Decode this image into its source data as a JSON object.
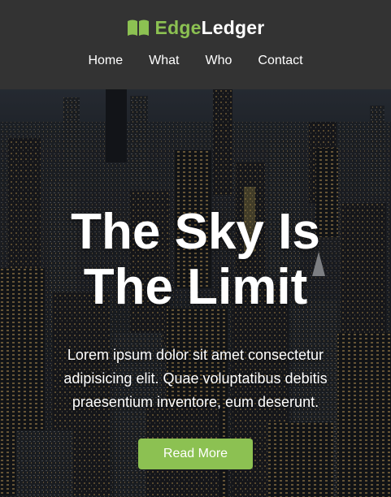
{
  "header": {
    "brand_accent": "Edge",
    "brand_rest": "Ledger",
    "logo_icon": "open-book-icon",
    "nav": [
      {
        "label": "Home"
      },
      {
        "label": "What"
      },
      {
        "label": "Who"
      },
      {
        "label": "Contact"
      }
    ]
  },
  "hero": {
    "title_line1": "The Sky Is",
    "title_line2": "The Limit",
    "text_line1": "Lorem ipsum dolor sit amet consectetur",
    "text_line2": "adipisicing elit. Quae voluptatibus debitis",
    "text_line3": "praesentium inventore, eum deserunt.",
    "button_label": "Read More",
    "background_image": "night-city-skyline"
  },
  "colors": {
    "header_bg": "#333333",
    "accent": "#8cc152",
    "text": "#ffffff"
  }
}
